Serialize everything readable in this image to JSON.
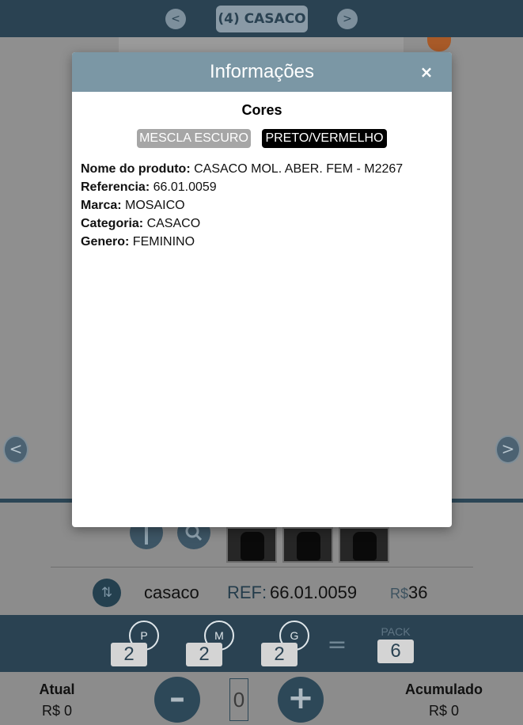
{
  "header": {
    "title": "(4) CASACO",
    "prev_icon": "chevron-left-icon",
    "next_icon": "chevron-right-icon",
    "prev_glyph": "<",
    "next_glyph": ">"
  },
  "gallery": {
    "prev_glyph": "<",
    "next_glyph": ">"
  },
  "modal": {
    "title": "Informações",
    "close_glyph": "×",
    "colors_heading": "Cores",
    "colors": [
      "MESCLA ESCURO",
      "PRETO/VERMELHO"
    ],
    "details": [
      {
        "label": "Nome do produto:",
        "value": "CASACO MOL. ABER. FEM - M2267"
      },
      {
        "label": "Referencia:",
        "value": "66.01.0059"
      },
      {
        "label": "Marca:",
        "value": "MOSAICO"
      },
      {
        "label": "Categoria:",
        "value": "CASACO"
      },
      {
        "label": "Genero:",
        "value": "FEMININO"
      }
    ]
  },
  "product": {
    "swap_glyph": "⇅",
    "name": "casaco",
    "ref_label": "REF:",
    "ref_value": "66.01.0059",
    "currency": "R$",
    "price": "36"
  },
  "sizes": [
    {
      "size": "P",
      "qty": "2"
    },
    {
      "size": "M",
      "qty": "2"
    },
    {
      "size": "G",
      "qty": "2"
    }
  ],
  "totals": {
    "equals": "=",
    "pack_label": "PACK",
    "pack_value": "6"
  },
  "footer": {
    "current_label": "Atual",
    "current_value": "R$ 0",
    "accum_label": "Acumulado",
    "accum_value": "R$ 0",
    "minus_glyph": "–",
    "plus_glyph": "+",
    "quantity": "0"
  },
  "colors": {
    "header_bg": "#2a4252",
    "modal_header_bg": "#7b97a5",
    "overlay_gray": "#8c8c8c"
  }
}
